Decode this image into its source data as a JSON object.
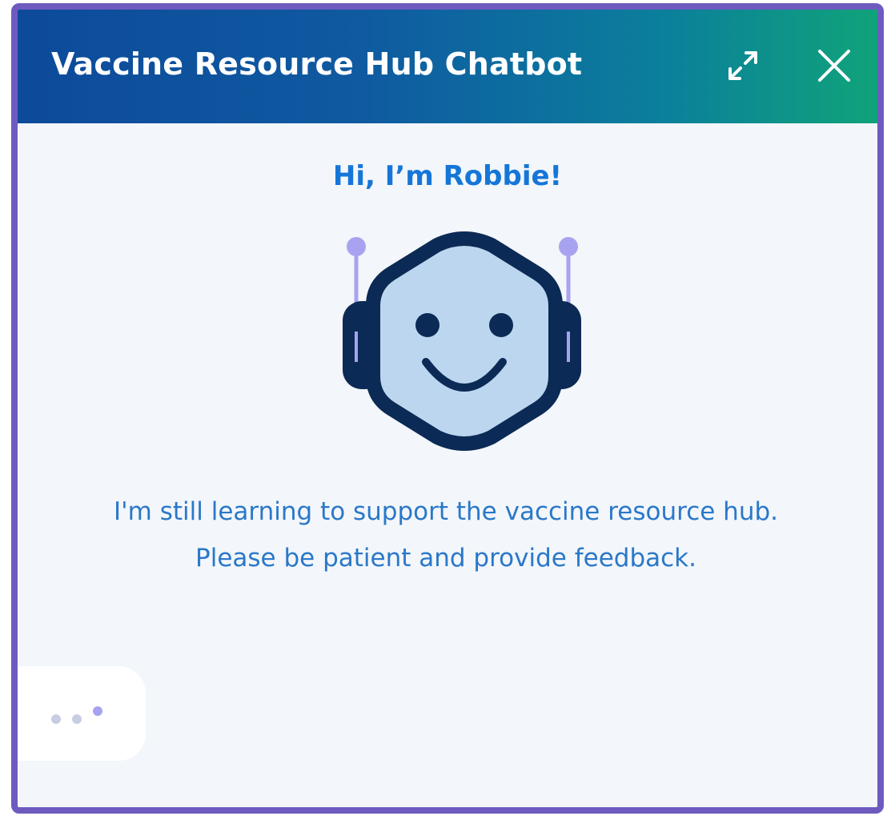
{
  "header": {
    "title": "Vaccine Resource Hub Chatbot",
    "expand_icon": "expand-arrows-icon",
    "close_icon": "close-x-icon"
  },
  "body": {
    "greeting": "Hi, I’m Robbie!",
    "avatar_icon": "robot-avatar-icon",
    "message": "I'm still learning to support the vaccine resource hub. Please be patient and provide feedback."
  },
  "typing_indicator": {
    "icon": "typing-dots-icon"
  },
  "colors": {
    "border": "#6f5bbf",
    "header_start": "#0d4a9a",
    "header_end": "#10a37a",
    "greeting": "#1576d8",
    "message": "#2a78c9",
    "background": "#f3f6fa",
    "robot_face": "#bcd6ef",
    "robot_outline": "#0b2a55",
    "antenna": "#a7a3f0"
  }
}
